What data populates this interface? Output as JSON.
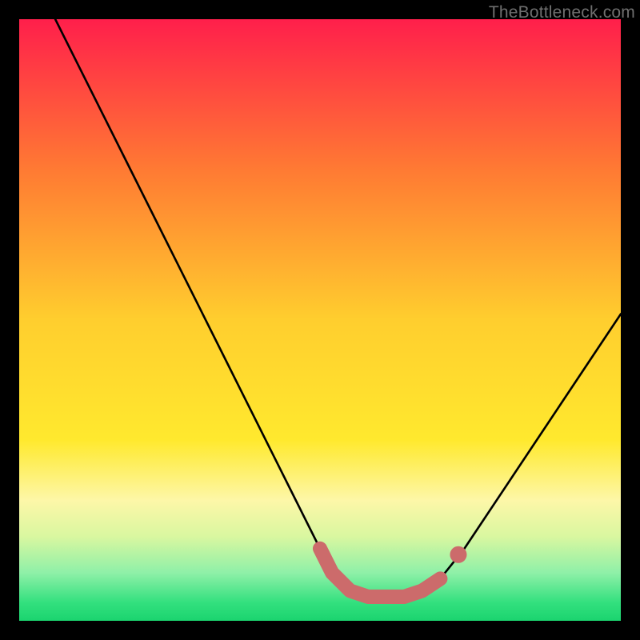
{
  "watermark": {
    "text": "TheBottleneck.com"
  },
  "colors": {
    "black": "#000000",
    "curve": "#000000",
    "marker": "#cc6b6b",
    "green": "#22e07a",
    "red_top": "#ff1f4b",
    "orange": "#ff9a2a",
    "yellow": "#ffe92e",
    "pale_yellow": "#fdf7a8"
  },
  "chart_data": {
    "type": "line",
    "title": "",
    "xlabel": "",
    "ylabel": "",
    "xlim": [
      0,
      100
    ],
    "ylim": [
      0,
      100
    ],
    "gradient_stops": [
      {
        "pos": 0.0,
        "color": "#ff1f4b"
      },
      {
        "pos": 0.25,
        "color": "#ff7a33"
      },
      {
        "pos": 0.5,
        "color": "#ffce2e"
      },
      {
        "pos": 0.7,
        "color": "#ffe92e"
      },
      {
        "pos": 0.8,
        "color": "#fdf7a8"
      },
      {
        "pos": 0.86,
        "color": "#d9f7a0"
      },
      {
        "pos": 0.92,
        "color": "#8ff0a8"
      },
      {
        "pos": 0.97,
        "color": "#32e07e"
      },
      {
        "pos": 1.0,
        "color": "#1bd46f"
      }
    ],
    "series": [
      {
        "name": "bottleneck-curve",
        "x": [
          6,
          10,
          14,
          18,
          22,
          26,
          30,
          34,
          38,
          42,
          46,
          50,
          52,
          55,
          58,
          61,
          64,
          67,
          70,
          74,
          78,
          82,
          86,
          90,
          94,
          98,
          100
        ],
        "y": [
          100,
          92,
          84,
          76,
          68,
          60,
          52,
          44,
          36,
          28,
          20,
          12,
          8,
          5,
          4,
          4,
          4,
          5,
          7,
          12,
          18,
          24,
          30,
          36,
          42,
          48,
          51
        ]
      }
    ],
    "highlight_segment": {
      "name": "optimal-zone",
      "x": [
        50,
        52,
        55,
        58,
        61,
        64,
        67,
        70
      ],
      "y": [
        12,
        8,
        5,
        4,
        4,
        4,
        5,
        7
      ]
    },
    "highlight_dot": {
      "x": 73,
      "y": 11
    }
  }
}
